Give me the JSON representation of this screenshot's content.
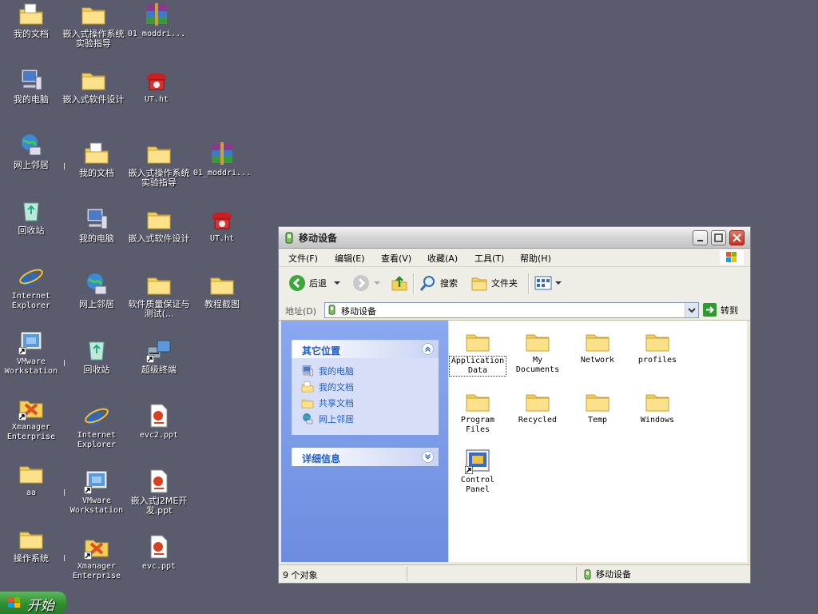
{
  "desktop": {
    "icons": [
      {
        "label": "我的文档",
        "icon": "my-documents-icon"
      },
      {
        "label": "嵌入式操作系统实验指导",
        "icon": "folder-icon"
      },
      {
        "label": "01_moddri...",
        "icon": "winrar-archive-icon"
      },
      {
        "label": "我的电脑",
        "icon": "my-computer-icon"
      },
      {
        "label": "嵌入式软件设计",
        "icon": "folder-icon"
      },
      {
        "label": "UT.ht",
        "icon": "hyperterminal-icon"
      },
      {
        "label": "网上邻居",
        "icon": "network-places-icon"
      },
      {
        "label": "我的文档",
        "icon": "my-documents-icon"
      },
      {
        "label": "嵌入式操作系统实验指导",
        "icon": "folder-icon"
      },
      {
        "label": "01_moddri...",
        "icon": "winrar-archive-icon"
      },
      {
        "label": "回收站",
        "icon": "recycle-bin-icon"
      },
      {
        "label": "我的电脑",
        "icon": "my-computer-icon"
      },
      {
        "label": "嵌入式软件设计",
        "icon": "folder-icon"
      },
      {
        "label": "UT.ht",
        "icon": "hyperterminal-icon"
      },
      {
        "label": "Internet Explorer",
        "icon": "internet-explorer-icon"
      },
      {
        "label": "网上邻居",
        "icon": "network-places-icon"
      },
      {
        "label": "软件质量保证与测试(...",
        "icon": "folder-icon"
      },
      {
        "label": "教程截图",
        "icon": "folder-icon"
      },
      {
        "label": "VMware Workstation",
        "icon": "vmware-icon"
      },
      {
        "label": "回收站",
        "icon": "recycle-bin-icon"
      },
      {
        "label": "超级终端",
        "icon": "terminal-icon"
      },
      {
        "label": "Xmanager Enterprise",
        "icon": "xmanager-icon"
      },
      {
        "label": "Internet Explorer",
        "icon": "internet-explorer-icon"
      },
      {
        "label": "evc2.ppt",
        "icon": "powerpoint-icon"
      },
      {
        "label": "aa",
        "icon": "folder-icon"
      },
      {
        "label": "VMware Workstation",
        "icon": "vmware-icon"
      },
      {
        "label": "嵌入式J2ME开发.ppt",
        "icon": "powerpoint-icon"
      },
      {
        "label": "操作系统",
        "icon": "folder-icon"
      },
      {
        "label": "Xmanager Enterprise",
        "icon": "xmanager-icon"
      },
      {
        "label": "evc.ppt",
        "icon": "powerpoint-icon"
      }
    ]
  },
  "taskbar": {
    "start_label": "开始"
  },
  "window": {
    "title": "移动设备",
    "menu": [
      "文件(F)",
      "编辑(E)",
      "查看(V)",
      "收藏(A)",
      "工具(T)",
      "帮助(H)"
    ],
    "toolbar": {
      "back": "后退",
      "search": "搜索",
      "folders": "文件夹"
    },
    "address": {
      "label": "地址(D)",
      "value": "移动设备",
      "go": "转到"
    },
    "other_places": {
      "title": "其它位置",
      "items": [
        "我的电脑",
        "我的文档",
        "共享文档",
        "网上邻居"
      ]
    },
    "details": {
      "title": "详细信息"
    },
    "files": [
      {
        "label": "Application Data",
        "icon": "folder-icon"
      },
      {
        "label": "My Documents",
        "icon": "folder-icon"
      },
      {
        "label": "Network",
        "icon": "folder-icon"
      },
      {
        "label": "profiles",
        "icon": "folder-icon"
      },
      {
        "label": "Program Files",
        "icon": "folder-icon"
      },
      {
        "label": "Recycled",
        "icon": "folder-icon"
      },
      {
        "label": "Temp",
        "icon": "folder-icon"
      },
      {
        "label": "Windows",
        "icon": "folder-icon"
      },
      {
        "label": "Control Panel",
        "icon": "control-panel-shortcut-icon"
      }
    ],
    "status": {
      "count": "9 个对象",
      "location": "移动设备"
    }
  }
}
